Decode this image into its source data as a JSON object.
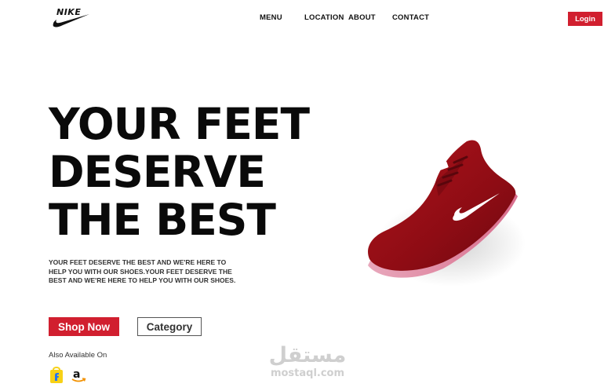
{
  "brand": {
    "logo_text": "NIKE",
    "logo_icon": "swoosh-icon"
  },
  "nav": {
    "menu": "MENU",
    "location": "LOCATION",
    "about": "ABOUT",
    "contact": "CONTACT"
  },
  "header": {
    "login_label": "Login"
  },
  "hero": {
    "headline_line1": "YOUR FEET",
    "headline_line2": "DESERVE",
    "headline_line3": "THE BEST",
    "description": "YOUR FEET DESERVE THE BEST AND WE'RE HERE TO HELP YOU WITH OUR SHOES.YOUR FEET DESERVE THE BEST AND WE'RE HERE TO HELP YOU WITH OUR SHOES.",
    "shop_now_label": "Shop Now",
    "category_label": "Category",
    "available_label": "Also Available On",
    "stores": [
      "flipkart-icon",
      "amazon-icon"
    ]
  },
  "watermark": {
    "arabic": "مستقل",
    "latin": "mostaql.com"
  },
  "colors": {
    "accent": "#d11f2f",
    "text": "#0a0a0a",
    "background": "#ffffff"
  }
}
